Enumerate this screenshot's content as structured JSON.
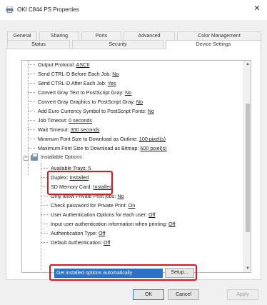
{
  "window": {
    "title": "OKI C844 PS Properties",
    "icon": "printer-icon",
    "close_glyph": "✕"
  },
  "tabs_row1": [
    {
      "label": "General"
    },
    {
      "label": "Sharing"
    },
    {
      "label": "Ports"
    },
    {
      "label": "Advanced"
    },
    {
      "label": "Color Management"
    }
  ],
  "tabs_row2": [
    {
      "label": "Status"
    },
    {
      "label": "Security"
    },
    {
      "label": "Device Settings",
      "active": true
    }
  ],
  "tree": {
    "items_top": [
      {
        "label": "Output Protocol:",
        "value": "ASCII"
      },
      {
        "label": "Send CTRL-D Before Each Job:",
        "value": "No"
      },
      {
        "label": "Send CTRL-D After Each Job:",
        "value": "Yes"
      },
      {
        "label": "Convert Gray Text to PostScript Gray:",
        "value": "No"
      },
      {
        "label": "Convert Gray Graphics to PostScript Gray:",
        "value": "No"
      },
      {
        "label": "Add Euro Currency Symbol to PostScript Fonts:",
        "value": "No"
      },
      {
        "label": "Job Timeout:",
        "value": "0 seconds"
      },
      {
        "label": "Wait Timeout:",
        "value": "300 seconds"
      },
      {
        "label": "Minimum Font Size to Download as Outline:",
        "value": "100 pixel(s)"
      },
      {
        "label": "Maximum Font Size to Download as Bitmap:",
        "value": "600 pixel(s)"
      }
    ],
    "group_label": "Installable Options",
    "group_expander": "−",
    "items_options": [
      {
        "label": "Available Trays:",
        "value": "5"
      },
      {
        "label": "Duplex:",
        "value": "Installed"
      },
      {
        "label": "SD Memory Card:",
        "value": "Installed"
      },
      {
        "label": "Only allow Private Print jobs:",
        "value": "No"
      },
      {
        "label": "Check password for Private Print:",
        "value": "On"
      },
      {
        "label": "User Authentication Options for each user:",
        "value": "Off"
      },
      {
        "label": "Input user authentication information when printing:",
        "value": "Off"
      },
      {
        "label": "Authentication Type:",
        "value": "Off"
      },
      {
        "label": "Default Authentication:",
        "value": "Off"
      }
    ],
    "auto_button": "Get installed options automatically",
    "setup_button": "Setup...",
    "scroll_up": "▲",
    "scroll_down": "▼"
  },
  "footer": {
    "ok": "OK",
    "cancel": "Cancel",
    "apply": "Apply"
  },
  "colors": {
    "highlight_box": "#e0141e",
    "selection_blue": "#2a72c8"
  }
}
